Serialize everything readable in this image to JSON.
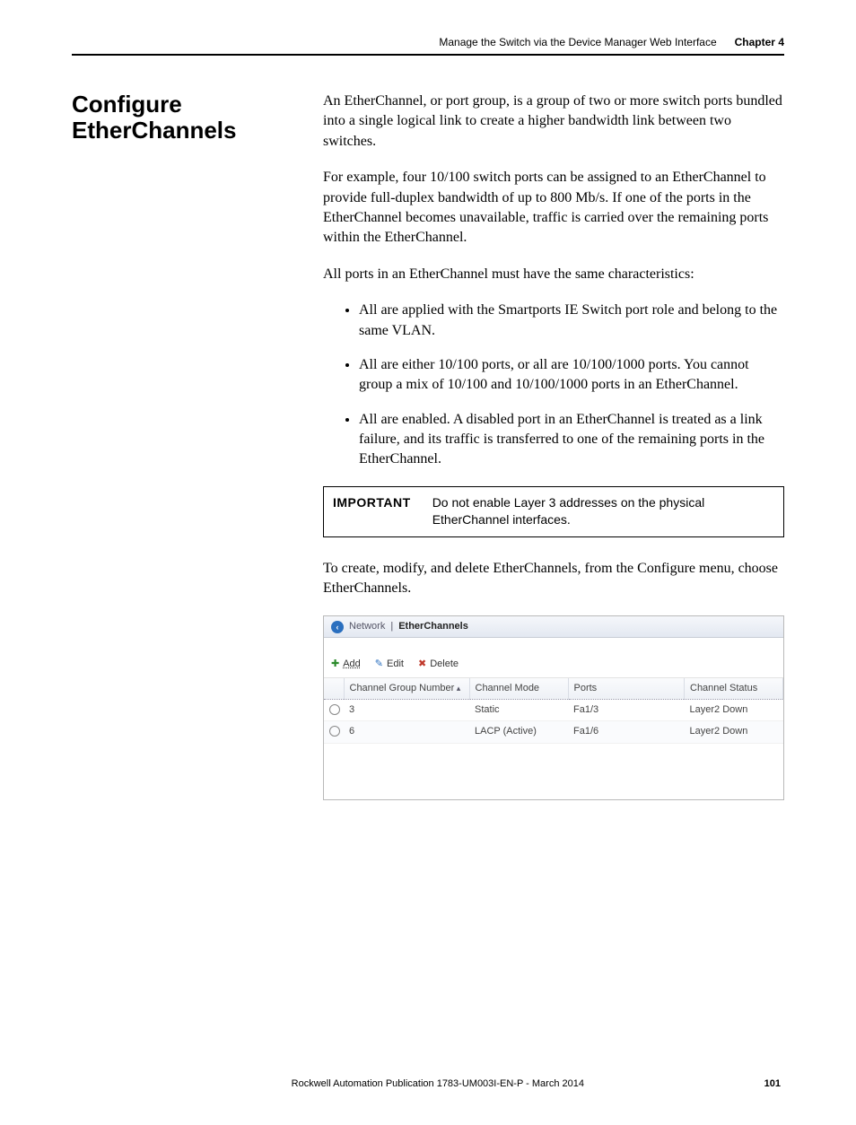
{
  "header": {
    "chapter_title": "Manage the Switch via the Device Manager Web Interface",
    "chapter_label": "Chapter 4"
  },
  "heading": "Configure EtherChannels",
  "paragraphs": {
    "p1": "An EtherChannel, or port group, is a group of two or more switch ports bundled into a single logical link to create a higher bandwidth link between two switches.",
    "p2": "For example, four 10/100 switch ports can be assigned to an EtherChannel to provide full-duplex bandwidth of up to 800 Mb/s. If one of the ports in the EtherChannel becomes unavailable, traffic is carried over the remaining ports within the EtherChannel.",
    "p3": "All ports in an EtherChannel must have the same characteristics:",
    "li1": "All are applied with the Smartports IE Switch port role and belong to the same VLAN.",
    "li2": "All are either 10/100 ports, or all are 10/100/1000 ports. You cannot group a mix of 10/100 and 10/100/1000 ports in an EtherChannel.",
    "li3": "All are enabled. A disabled port in an EtherChannel is treated as a link failure, and its traffic is transferred to one of the remaining ports in the EtherChannel.",
    "p4": "To create, modify, and delete EtherChannels, from the Configure menu, choose EtherChannels."
  },
  "important": {
    "label": "IMPORTANT",
    "text": "Do not enable Layer 3 addresses on the physical EtherChannel interfaces."
  },
  "screenshot": {
    "breadcrumb": {
      "back_glyph": "‹",
      "parent": "Network",
      "sep": "|",
      "current": "EtherChannels"
    },
    "toolbar": {
      "add": "Add",
      "edit": "Edit",
      "delete": "Delete"
    },
    "columns": {
      "c1": "Channel Group Number",
      "c2": "Channel Mode",
      "c3": "Ports",
      "c4": "Channel Status"
    },
    "rows": [
      {
        "num": "3",
        "mode": "Static",
        "ports": "Fa1/3",
        "status": "Layer2 Down"
      },
      {
        "num": "6",
        "mode": "LACP (Active)",
        "ports": "Fa1/6",
        "status": "Layer2 Down"
      }
    ]
  },
  "footer": {
    "pub": "Rockwell Automation Publication 1783-UM003I-EN-P - March 2014",
    "page": "101"
  }
}
